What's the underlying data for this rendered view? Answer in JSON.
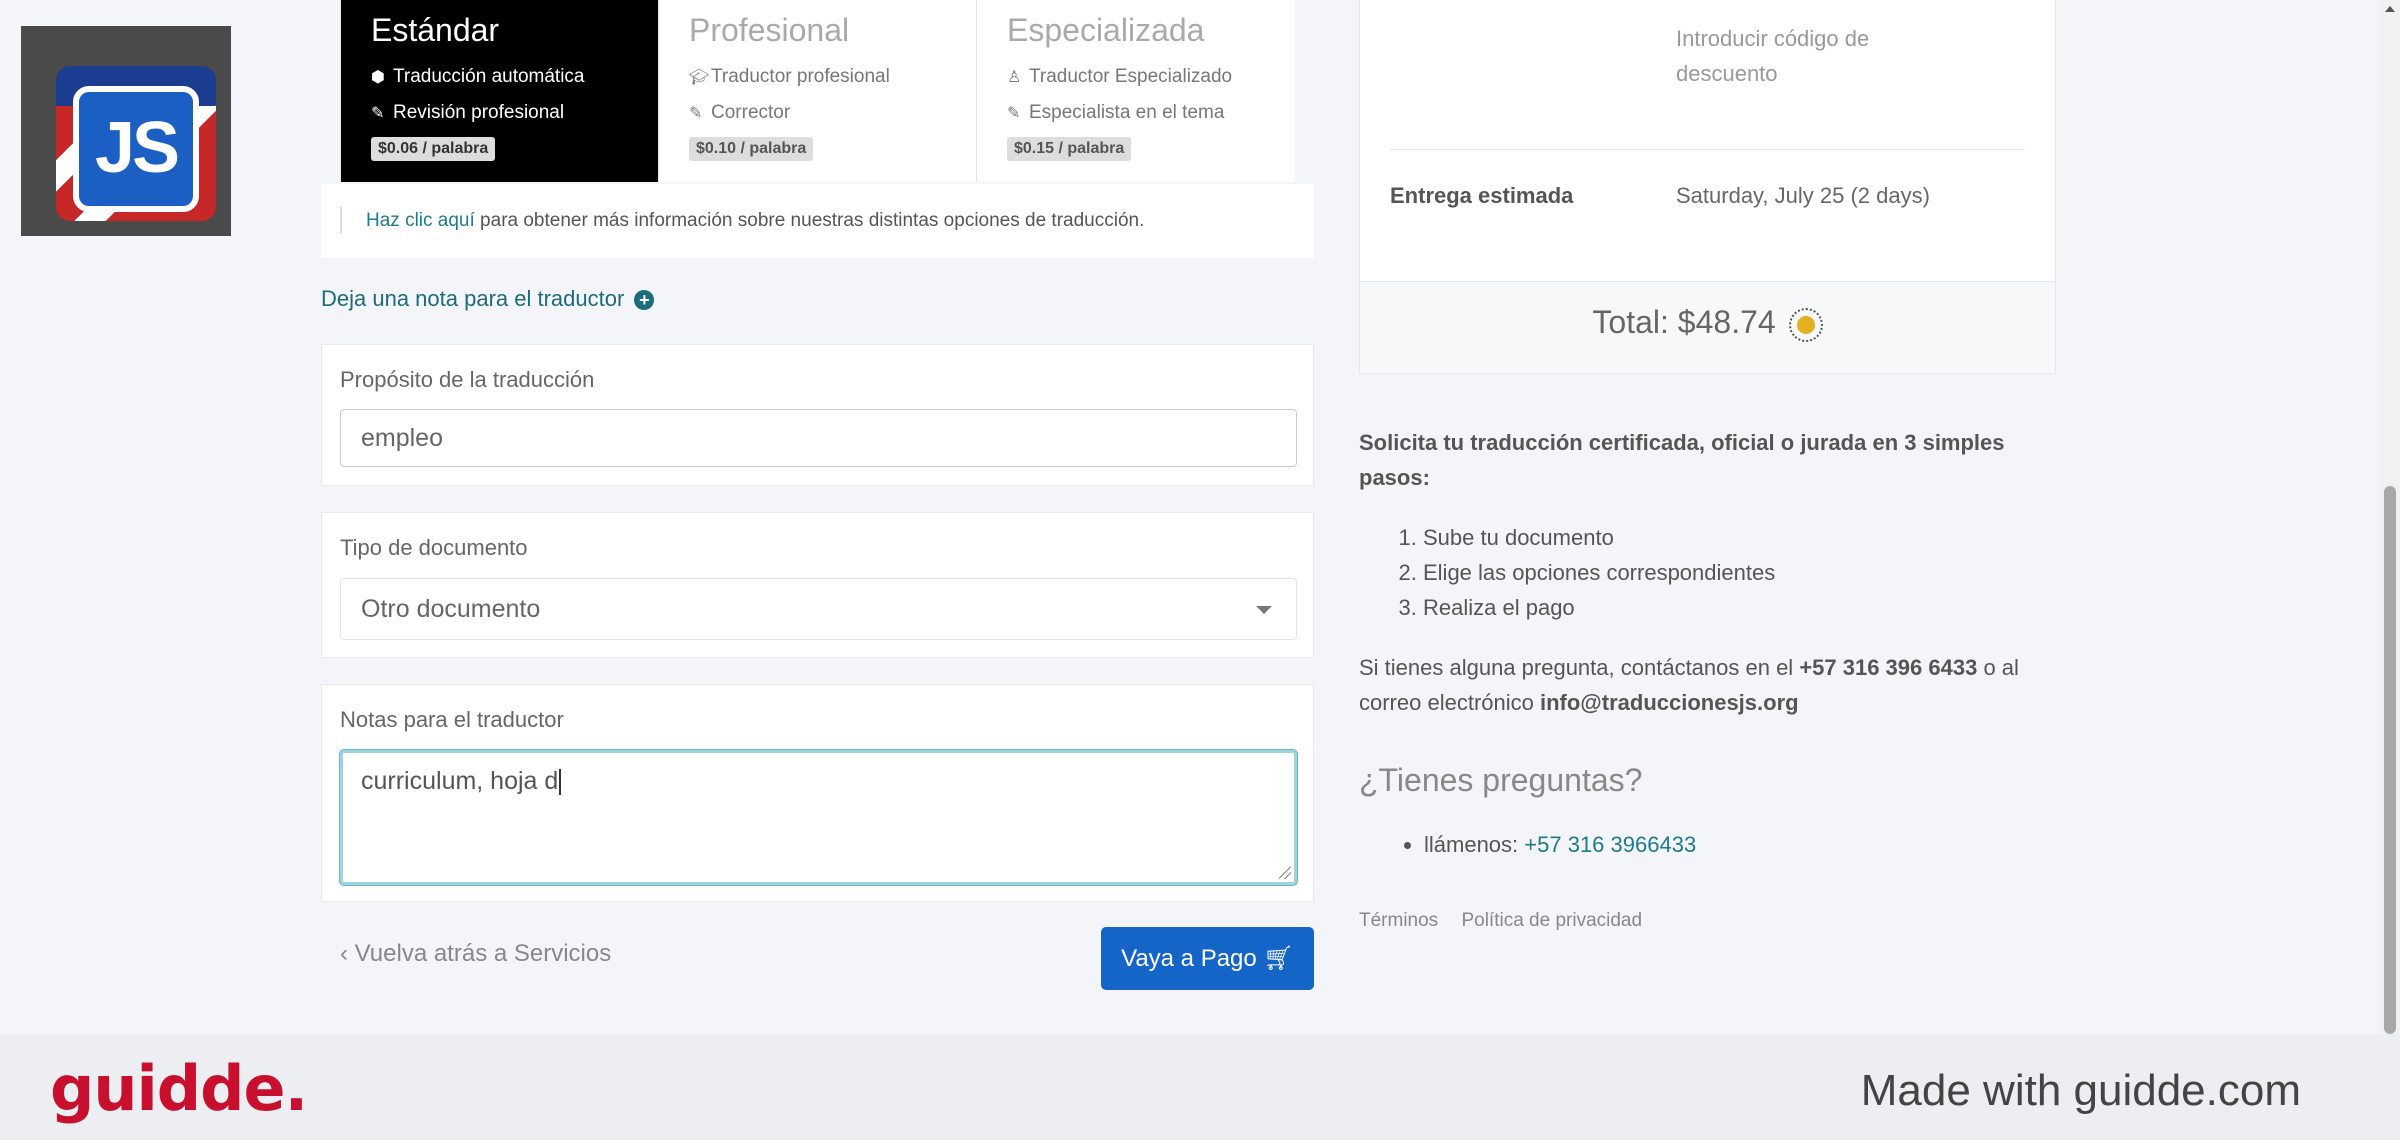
{
  "tiers": [
    {
      "name": "Estándar",
      "features": [
        {
          "icon": "robot-icon",
          "text": "Traducción automática"
        },
        {
          "icon": "edit-icon",
          "text": "Revisión profesional"
        }
      ],
      "price": "$0.06 / palabra",
      "selected": true
    },
    {
      "name": "Profesional",
      "features": [
        {
          "icon": "graduation-cap-icon",
          "text": "Traductor profesional"
        },
        {
          "icon": "edit-icon",
          "text": "Corrector"
        }
      ],
      "price": "$0.10 / palabra",
      "selected": false
    },
    {
      "name": "Especializada",
      "features": [
        {
          "icon": "user-tie-icon",
          "text": "Traductor Especializado"
        },
        {
          "icon": "edit-icon",
          "text": "Especialista en el tema"
        }
      ],
      "price": "$0.15 / palabra",
      "selected": false
    }
  ],
  "info": {
    "link": "Haz clic aquí",
    "text": " para obtener más información sobre nuestras distintas opciones de traducción."
  },
  "note_link": "Deja una nota para el traductor",
  "purpose": {
    "label": "Propósito de la traducción",
    "value": "empleo"
  },
  "doc_type": {
    "label": "Tipo de documento",
    "value": "Otro documento"
  },
  "notes": {
    "label": "Notas para el traductor",
    "value": "curriculum, hoja d"
  },
  "back_link": "Vuelva atrás a Servicios",
  "pay_button": "Vaya a Pago",
  "summary": {
    "discount_placeholder": "Introducir código de descuento",
    "delivery_label": "Entrega estimada",
    "delivery_value": "Saturday, July 25 (2 days)",
    "total": "Total: $48.74"
  },
  "side": {
    "headline": "Solicita tu traducción certificada, oficial o jurada en 3 simples pasos:",
    "steps": [
      "Sube tu documento",
      "Elige las opciones correspondientes",
      "Realiza el pago"
    ],
    "contact_pre": "Si tienes alguna pregunta, contáctanos en el ",
    "contact_phone": "+57 316 396 6433",
    "contact_mid": " o al correo electrónico ",
    "contact_email": "info@traduccionesjs.org",
    "faq_title": "¿Tienes preguntas?",
    "call_label": "llámenos: ",
    "call_phone": "+57 316 3966433",
    "links": [
      "Términos",
      "Política de privacidad"
    ]
  },
  "banner": {
    "brand": "guidde.",
    "made_with": "Made with guidde.com"
  },
  "colors": {
    "accent": "#1565c8",
    "link": "#1e7a8c",
    "brand": "#c8102e",
    "selected_tier": "#000000"
  }
}
